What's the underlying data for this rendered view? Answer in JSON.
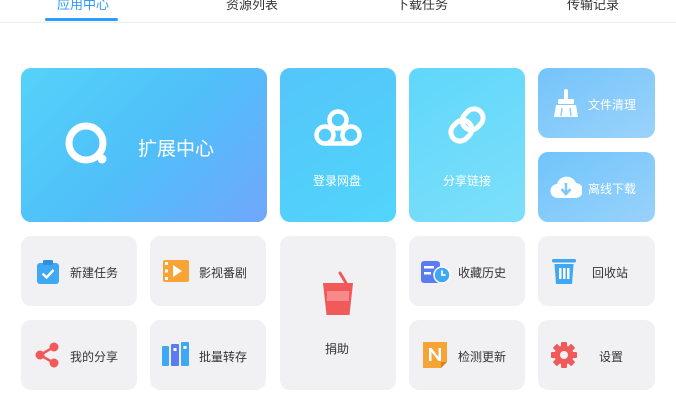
{
  "tabs": [
    {
      "label": "应用中心",
      "active": true
    },
    {
      "label": "资源列表",
      "active": false
    },
    {
      "label": "下载任务",
      "active": false
    },
    {
      "label": "传输记录",
      "active": false
    }
  ],
  "cards": {
    "extension_center": "扩展中心",
    "login_netdisk": "登录网盘",
    "share_link": "分享链接",
    "file_clean": "文件清理",
    "offline_download": "离线下载",
    "new_task": "新建任务",
    "video": "影视番剧",
    "donate": "捐助",
    "favorites": "收藏历史",
    "recycle": "回收站",
    "my_share": "我的分享",
    "batch_transfer": "批量转存",
    "check_update": "检测更新",
    "settings": "设置"
  },
  "colors": {
    "accent": "#2e9bff",
    "card_gray": "#f1f1f3",
    "icon_blue": "#3ea8f5",
    "icon_orange": "#f7a437",
    "icon_red": "#f05a5a",
    "icon_indigo": "#5a7cf0"
  }
}
